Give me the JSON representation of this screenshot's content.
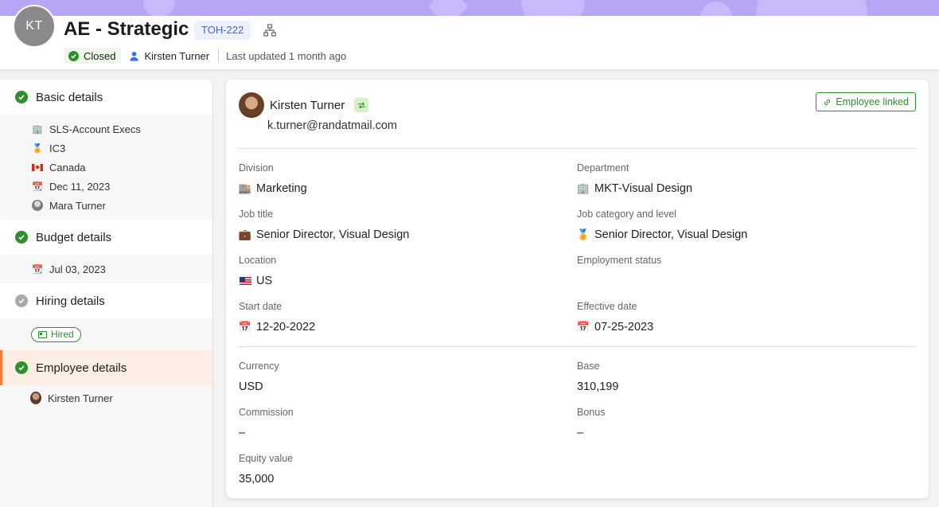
{
  "header": {
    "avatar_initials": "KT",
    "title": "AE - Strategic",
    "id_badge": "TOH-222",
    "status": "Closed",
    "owner": "Kirsten Turner",
    "last_updated": "Last updated 1 month ago"
  },
  "sidebar": {
    "sections": [
      {
        "title": "Basic details",
        "state": "complete",
        "items": [
          {
            "icon": "building-icon",
            "label": "SLS-Account Execs"
          },
          {
            "icon": "medal-icon",
            "label": "IC3"
          },
          {
            "icon": "canada-flag-icon",
            "label": "Canada"
          },
          {
            "icon": "calendar-icon",
            "label": "Dec 11, 2023"
          },
          {
            "icon": "avatar",
            "label": "Mara Turner"
          }
        ]
      },
      {
        "title": "Budget details",
        "state": "complete",
        "items": [
          {
            "icon": "calendar-icon",
            "label": "Jul 03, 2023"
          }
        ]
      },
      {
        "title": "Hiring details",
        "state": "pending",
        "badge": "Hired"
      },
      {
        "title": "Employee details",
        "state": "complete",
        "active": true,
        "items": [
          {
            "icon": "avatar",
            "label": "Kirsten Turner"
          }
        ]
      }
    ]
  },
  "employee": {
    "name": "Kirsten Turner",
    "email": "k.turner@randatmail.com",
    "linked_label": "Employee linked"
  },
  "fields": {
    "division": {
      "label": "Division",
      "value": "Marketing",
      "icon": "office-building-icon"
    },
    "department": {
      "label": "Department",
      "value": "MKT-Visual Design",
      "icon": "office-building-icon"
    },
    "job_title": {
      "label": "Job title",
      "value": "Senior Director, Visual Design",
      "icon": "briefcase-icon"
    },
    "job_category": {
      "label": "Job category and level",
      "value": "Senior Director, Visual Design",
      "icon": "medal-icon"
    },
    "location": {
      "label": "Location",
      "value": "US",
      "icon": "us-flag-icon"
    },
    "employment_status": {
      "label": "Employment status",
      "value": ""
    },
    "start_date": {
      "label": "Start date",
      "value": "12-20-2022",
      "icon": "calendar-icon"
    },
    "effective_date": {
      "label": "Effective date",
      "value": "07-25-2023",
      "icon": "calendar-icon"
    },
    "currency": {
      "label": "Currency",
      "value": "USD"
    },
    "base": {
      "label": "Base",
      "value": "310,199"
    },
    "commission": {
      "label": "Commission",
      "value": "–"
    },
    "bonus": {
      "label": "Bonus",
      "value": "–"
    },
    "equity_value": {
      "label": "Equity value",
      "value": "35,000"
    }
  },
  "colors": {
    "banner": "#b7a6f6",
    "success_green": "#2f8f2f",
    "active_accent": "#f07a3c",
    "id_badge_text": "#4a62d8"
  }
}
